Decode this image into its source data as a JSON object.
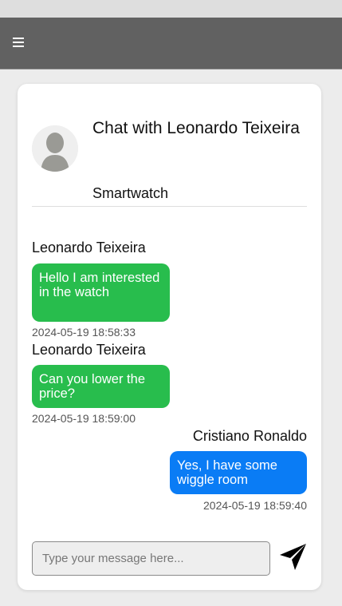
{
  "app": {
    "menu_icon": "hamburger-icon"
  },
  "chat": {
    "title": "Chat with Leonardo Teixeira",
    "product": "Smartwatch",
    "avatar_icon": "user-avatar-placeholder"
  },
  "messages": [
    {
      "sender": "Leonardo Teixeira",
      "text": "Hello I am interested in the watch",
      "time": "2024-05-19 18:58:33",
      "direction": "incoming"
    },
    {
      "sender": "Leonardo Teixeira",
      "text": "Can you lower the price?",
      "time": "2024-05-19 18:59:00",
      "direction": "incoming"
    },
    {
      "sender": "Cristiano Ronaldo",
      "text": "Yes, I have some wiggle room",
      "time": "2024-05-19 18:59:40",
      "direction": "outgoing"
    }
  ],
  "composer": {
    "placeholder": "Type your message here...",
    "value": "",
    "send_icon": "send-icon"
  },
  "colors": {
    "navbar": "#616161",
    "incoming_bubble": "#28bd4d",
    "outgoing_bubble": "#0a7cf5"
  }
}
